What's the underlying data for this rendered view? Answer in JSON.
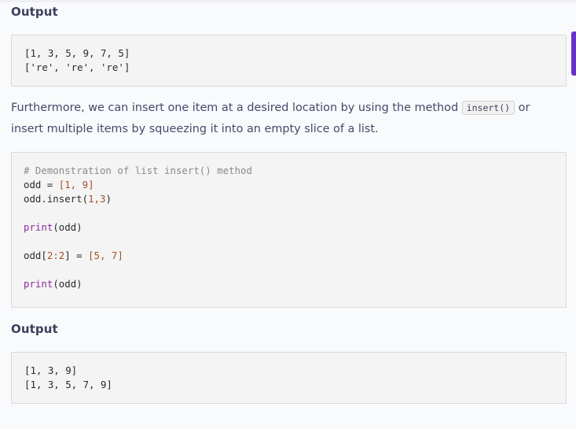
{
  "output_heading_1": "Output",
  "output_block_1": {
    "lines": [
      "[1, 3, 5, 9, 7, 5]",
      "['re', 're', 're']"
    ]
  },
  "paragraph": {
    "text_before": "Furthermore, we can insert one item at a desired location by using the method ",
    "inline_code": "insert()",
    "text_after": " or insert multiple items by squeezing it into an empty slice of a list."
  },
  "code_block": {
    "comment": "# Demonstration of list insert() method",
    "line2_var": "odd = ",
    "line2_val": "[1, 9]",
    "line3_pre": "odd.insert(",
    "line3_num": "1,3",
    "line3_post": ")",
    "print1_kw": "print",
    "print1_arg": "(odd)",
    "line6_pre": "odd[",
    "line6_idx": "2:2",
    "line6_mid": "] = ",
    "line6_val": "[5, 7]",
    "print2_kw": "print",
    "print2_arg": "(odd)"
  },
  "output_heading_2": "Output",
  "output_block_2": {
    "lines": [
      "[1, 3, 9]",
      "[1, 3, 5, 7, 9]"
    ]
  },
  "colors": {
    "accent": "#6a2fd1",
    "heading": "#3c3f5c",
    "text": "#45486b",
    "code_bg": "#f4f4f4",
    "keyword": "#8a2ba0",
    "number": "#a0522d",
    "comment": "#8a8a8a"
  }
}
